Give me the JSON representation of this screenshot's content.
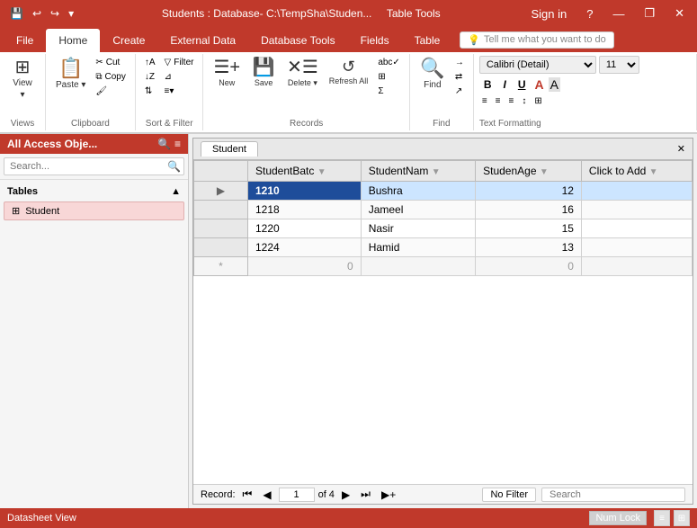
{
  "titleBar": {
    "title": "Students : Database- C:\\TempSha\\Studen...",
    "tableTools": "Table Tools",
    "signIn": "Sign in",
    "helpBtn": "?",
    "minimizeBtn": "—",
    "maximizeBtn": "❐",
    "closeBtn": "✕"
  },
  "quickAccess": {
    "saveIcon": "💾",
    "undoIcon": "↩",
    "redoIcon": "↪",
    "dropdownIcon": "▾"
  },
  "ribbonTabs": [
    {
      "label": "File",
      "active": false
    },
    {
      "label": "Home",
      "active": true
    },
    {
      "label": "Create",
      "active": false
    },
    {
      "label": "External Data",
      "active": false
    },
    {
      "label": "Database Tools",
      "active": false
    },
    {
      "label": "Fields",
      "active": false
    },
    {
      "label": "Table",
      "active": false
    }
  ],
  "ribbon": {
    "groups": [
      {
        "name": "views",
        "label": "Views",
        "buttons": [
          {
            "icon": "⊞",
            "label": "View",
            "hasDropdown": true
          }
        ]
      },
      {
        "name": "clipboard",
        "label": "Clipboard",
        "buttons": [
          {
            "icon": "📋",
            "label": "Paste",
            "hasDropdown": true
          },
          {
            "icon": "✂",
            "label": "Cut",
            "small": true
          },
          {
            "icon": "⧉",
            "label": "Copy",
            "small": true
          },
          {
            "icon": "✏",
            "label": "Format",
            "small": true
          }
        ]
      },
      {
        "name": "sortFilter",
        "label": "Sort & Filter",
        "buttons": [
          {
            "icon": "↕",
            "label": "",
            "small": true
          },
          {
            "icon": "▼",
            "label": "",
            "small": true
          },
          {
            "icon": "⇅",
            "label": "",
            "small": true
          }
        ]
      },
      {
        "name": "records",
        "label": "Records",
        "refreshLabel": "Refresh\nAll",
        "buttons": []
      },
      {
        "name": "find",
        "label": "Find",
        "buttons": [
          {
            "icon": "🔍",
            "label": "Find"
          }
        ]
      },
      {
        "name": "textFormatting",
        "label": "Text Formatting",
        "fontName": "Calibri (Detail)",
        "fontSize": "11",
        "boldLabel": "B",
        "italicLabel": "I",
        "underlineLabel": "U"
      }
    ],
    "tellMe": "Tell me what you want to do"
  },
  "leftPanel": {
    "title": "All Access Obje...",
    "searchPlaceholder": "Search...",
    "tablesLabel": "Tables",
    "tableItems": [
      {
        "icon": "⊞",
        "name": "Student"
      }
    ]
  },
  "tableWindow": {
    "title": "Student",
    "closeBtn": "✕",
    "columns": [
      {
        "name": "StudentBatc",
        "label": "StudentBatc"
      },
      {
        "name": "StudentName",
        "label": "StudentNam"
      },
      {
        "name": "StudentAge",
        "label": "StudenAge"
      },
      {
        "name": "clickToAdd",
        "label": "Click to Add"
      }
    ],
    "rows": [
      {
        "selector": "",
        "studentBatch": "1210",
        "studentName": "Bushra",
        "studentAge": "12",
        "selected": true,
        "batchSelected": true
      },
      {
        "selector": "",
        "studentBatch": "1218",
        "studentName": "Jameel",
        "studentAge": "16",
        "selected": false
      },
      {
        "selector": "",
        "studentBatch": "1220",
        "studentName": "Nasir",
        "studentAge": "15",
        "selected": false
      },
      {
        "selector": "",
        "studentBatch": "1224",
        "studentName": "Hamid",
        "studentAge": "13",
        "selected": false
      }
    ],
    "newRow": {
      "selector": "*",
      "value": "0",
      "age": "0"
    }
  },
  "statusBar": {
    "recordLabel": "Record:",
    "firstBtn": "⏮",
    "prevBtn": "◀",
    "currentRecord": "1",
    "ofLabel": "of 4",
    "nextBtn": "▶",
    "lastBtn": "⏭",
    "newBtn": "▶+",
    "noFilter": "No Filter",
    "searchLabel": "Search",
    "numLock": "Num Lock",
    "viewIcons": [
      "≡",
      "⊞"
    ]
  },
  "bottomStatus": {
    "label": "Datasheet View"
  }
}
